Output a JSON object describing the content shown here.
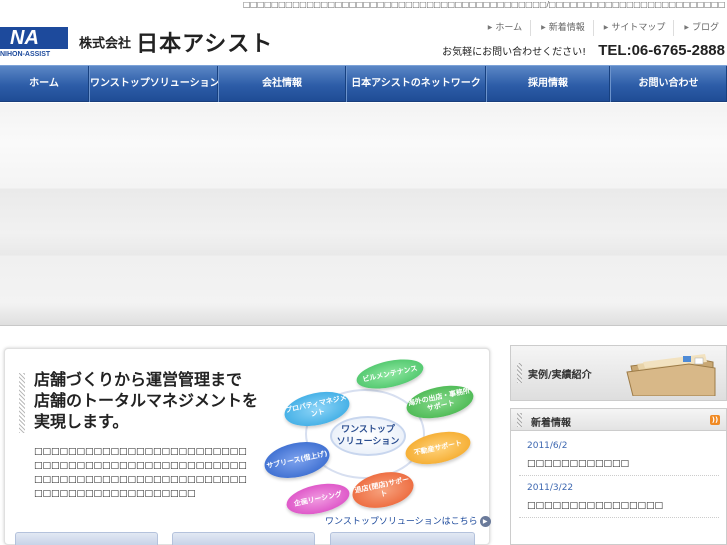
{
  "top_strip": {
    "tagline": "□□□□□□□□□□□□□□□□□□□□□□□□□□□□□□□□□□□□□□□□□□□/□□□□□□□□□□□□□□□□□□□□□□□□□"
  },
  "header": {
    "logo_letters": "NA",
    "logo_sub": "NIHON-ASSIST",
    "company_prefix": "株式会社",
    "company_name": "日本アシスト",
    "util_nav": [
      "ホーム",
      "新着情報",
      "サイトマップ",
      "ブログ"
    ],
    "contact_text": "お気軽にお問い合わせください!",
    "tel": "TEL:06-6765-2888"
  },
  "gnav": [
    {
      "label": "ホーム"
    },
    {
      "label": "ワンストップソリューション"
    },
    {
      "label": "会社情報"
    },
    {
      "label": "日本アシストのネットワーク"
    },
    {
      "label": "採用情報"
    },
    {
      "label": "お問い合わせ"
    }
  ],
  "solution": {
    "headline": [
      "店舗づくりから運営管理まで",
      "店舗のトータルマネジメントを",
      "実現します。"
    ],
    "description": "□□□□□□□□□□□□□□□□□□□□□□□□□□□□□□□□□□□□□□□□□□□□□□□□□□□□□□□□□□□□□□□□□□□□□□□□□□□□□□□□□□□□□□□□□□□□□□",
    "more_link": "ワンストップソリューションはこちら",
    "diagram": {
      "center": [
        "ワンストップ",
        "ソリューション"
      ],
      "items": [
        {
          "label": "ビルメンテナンス",
          "color": "#3fbf5f"
        },
        {
          "label": "海外の出店・事務所サポート",
          "color": "#3cb043"
        },
        {
          "label": "プロパティマネジメント",
          "color": "#2aa3e0"
        },
        {
          "label": "不動産サポート",
          "color": "#f2a21c"
        },
        {
          "label": "サブリース(借上げ)",
          "color": "#2a5fc8"
        },
        {
          "label": "退店(閉店)サポート",
          "color": "#ea5a2b"
        },
        {
          "label": "企画リーシング",
          "color": "#d83fc0"
        }
      ]
    }
  },
  "cases": {
    "label": "実例/実績紹介"
  },
  "news": {
    "title": "新着情報",
    "items": [
      {
        "date": "2011/6/2",
        "title": "□□□□□□□□□□□□"
      },
      {
        "date": "2011/3/22",
        "title": "□□□□□□□□□□□□□□□□"
      }
    ]
  }
}
